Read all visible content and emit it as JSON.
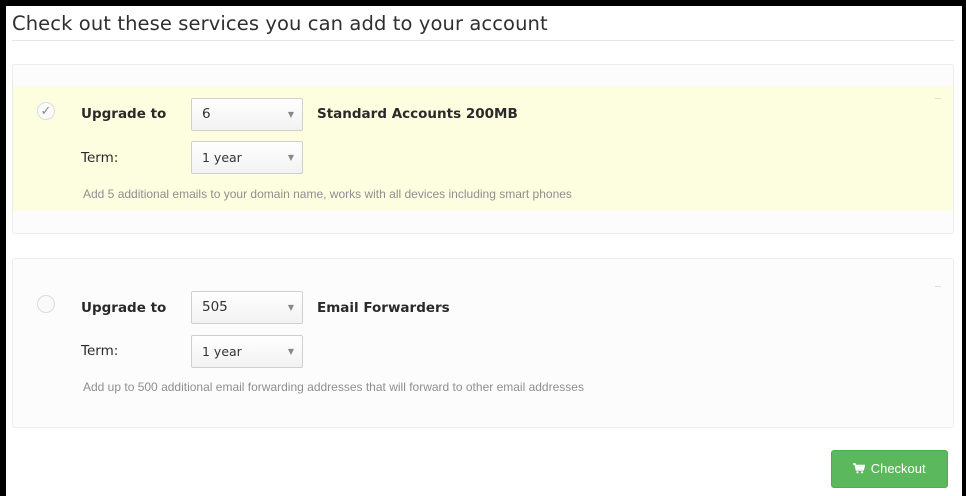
{
  "heading": "Check out these services you can add to your account",
  "services": [
    {
      "selected": true,
      "upgrade_label": "Upgrade to",
      "quantity": "6",
      "product": "Standard Accounts 200MB",
      "term_label": "Term:",
      "term": "1 year",
      "description": "Add 5 additional emails to your domain name, works with all devices including smart phones"
    },
    {
      "selected": false,
      "upgrade_label": "Upgrade to",
      "quantity": "505",
      "product": "Email Forwarders",
      "term_label": "Term:",
      "term": "1 year",
      "description": "Add up to 500 additional email forwarding addresses that will forward to other email addresses"
    }
  ],
  "icons": {
    "check": "✓",
    "caret": "▼",
    "cart": "cart-icon"
  },
  "checkout_label": "Checkout",
  "colors": {
    "highlight": "#fdfde0",
    "checkout": "#5cb85c"
  }
}
